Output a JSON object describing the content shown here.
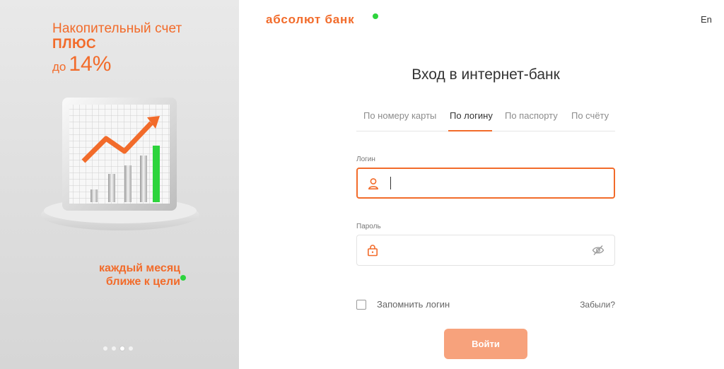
{
  "promo": {
    "line1": "Накопительный счет",
    "line2": "ПЛЮС",
    "line3_prefix": "до",
    "line3_rate": "14%",
    "bottom_line1": "каждый месяц",
    "bottom_line2": "ближе к цели",
    "carousel": {
      "count": 4,
      "active_index": 2
    },
    "colors": {
      "accent": "#f26b2a",
      "green": "#2dd43c"
    }
  },
  "header": {
    "logo_text": "абсолют банк",
    "language": "En"
  },
  "login": {
    "title": "Вход в интернет-банк",
    "tabs": [
      {
        "label": "По номеру карты",
        "active": false
      },
      {
        "label": "По логину",
        "active": true
      },
      {
        "label": "По паспорту",
        "active": false
      },
      {
        "label": "По счёту",
        "active": false
      }
    ],
    "login_field": {
      "label": "Логин",
      "value": "",
      "icon": "user-icon"
    },
    "password_field": {
      "label": "Пароль",
      "value": "",
      "icon": "lock-icon",
      "toggle_icon": "eye-off-icon"
    },
    "remember_label": "Запомнить логин",
    "remember_checked": false,
    "forgot_label": "Забыли?",
    "submit_label": "Войти"
  },
  "colors": {
    "accent": "#f26b2a",
    "button_disabled": "#f7a27c"
  }
}
